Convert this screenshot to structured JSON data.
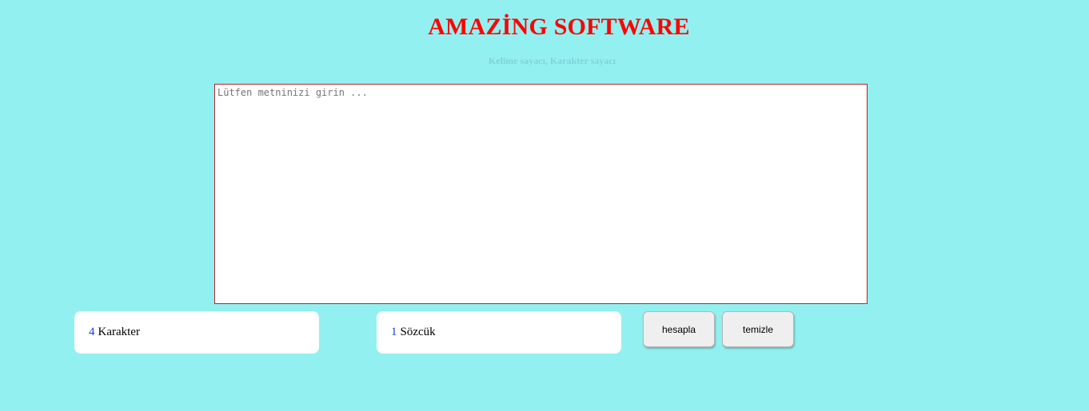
{
  "header": {
    "title": "AMAZİNG SOFTWARE",
    "subtitle": "Kelime sayacı, Karakter sayacı"
  },
  "editor": {
    "placeholder": "Lütfen metninizi girin ...",
    "value": ""
  },
  "counters": {
    "characters": {
      "count": "4",
      "label": "Karakter"
    },
    "words": {
      "count": "1",
      "label": "Sözcük"
    }
  },
  "buttons": {
    "calculate_label": "hesapla",
    "clear_label": "temizle"
  },
  "colors": {
    "background": "#92f1f0",
    "title": "#ff0000",
    "subtitle": "#7fd2d8",
    "count_number": "#1a3fd6",
    "editor_border": "#b3262a"
  }
}
